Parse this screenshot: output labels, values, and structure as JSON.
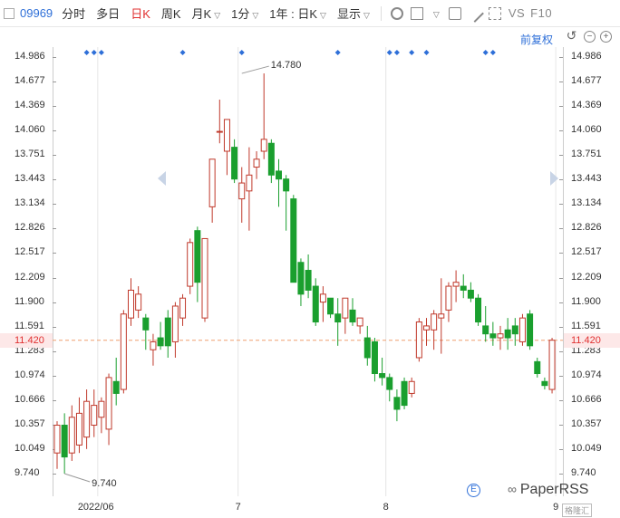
{
  "toolbar": {
    "code": "09969",
    "items": [
      {
        "label": "分时",
        "active": false,
        "caret": false
      },
      {
        "label": "多日",
        "active": false,
        "caret": false
      },
      {
        "label": "日K",
        "active": true,
        "caret": false
      },
      {
        "label": "周K",
        "active": false,
        "caret": false
      },
      {
        "label": "月K",
        "active": false,
        "caret": true
      },
      {
        "label": "1分",
        "active": false,
        "caret": true
      },
      {
        "label": "1年 : 日K",
        "active": false,
        "caret": true
      },
      {
        "label": "显示",
        "active": false,
        "caret": true
      }
    ],
    "right_text_1": "VS",
    "right_text_2": "F10",
    "icons": [
      "gear-icon",
      "checkbox-icon",
      "camera-icon",
      "pen-icon",
      "expand-icon"
    ]
  },
  "adjust_label": "前复权",
  "colors": {
    "up": "#c0392b",
    "down": "#1a9f2e",
    "axis_text": "#333333",
    "current": "#e03030",
    "marker": "#2e6fd8"
  },
  "watermark": {
    "e_icon": "E",
    "text": "PaperRSS",
    "sub": "格隆汇"
  },
  "chart_data": {
    "type": "candlestick",
    "y_ticks": [
      "14.986",
      "14.677",
      "14.369",
      "14.060",
      "13.751",
      "13.443",
      "13.134",
      "12.826",
      "12.517",
      "12.209",
      "11.900",
      "11.591",
      "11.283",
      "10.974",
      "10.666",
      "10.357",
      "10.049",
      "9.740"
    ],
    "ylim": [
      9.74,
      14.986
    ],
    "x_labels": [
      {
        "label": "2022/06",
        "index": 5.5
      },
      {
        "label": "7",
        "index": 24.5
      },
      {
        "label": "8",
        "index": 44.5
      },
      {
        "label": "9",
        "index": 67.5
      }
    ],
    "current_price": "11.420",
    "current_value": 11.42,
    "high_annotation": {
      "label": "14.780",
      "index": 25,
      "value": 14.78
    },
    "low_annotation": {
      "label": "9.740",
      "index": 1,
      "value": 9.74
    },
    "top_markers": [
      4,
      5,
      6,
      17,
      25,
      38,
      45,
      46,
      48,
      50,
      58,
      59
    ],
    "candles": [
      {
        "o": 10.0,
        "h": 10.4,
        "l": 9.8,
        "c": 10.35
      },
      {
        "o": 10.35,
        "h": 10.5,
        "l": 9.74,
        "c": 9.95
      },
      {
        "o": 10.0,
        "h": 10.6,
        "l": 9.9,
        "c": 10.45
      },
      {
        "o": 10.1,
        "h": 10.7,
        "l": 10.0,
        "c": 10.5
      },
      {
        "o": 10.2,
        "h": 10.8,
        "l": 10.05,
        "c": 10.65
      },
      {
        "o": 10.35,
        "h": 10.8,
        "l": 10.2,
        "c": 10.6
      },
      {
        "o": 10.45,
        "h": 10.7,
        "l": 10.25,
        "c": 10.65
      },
      {
        "o": 10.3,
        "h": 11.0,
        "l": 10.1,
        "c": 10.95
      },
      {
        "o": 10.9,
        "h": 11.2,
        "l": 10.6,
        "c": 10.75
      },
      {
        "o": 10.8,
        "h": 11.8,
        "l": 10.75,
        "c": 11.75
      },
      {
        "o": 11.7,
        "h": 12.2,
        "l": 11.6,
        "c": 12.05
      },
      {
        "o": 11.8,
        "h": 12.1,
        "l": 11.7,
        "c": 12.0
      },
      {
        "o": 11.7,
        "h": 11.75,
        "l": 11.3,
        "c": 11.55
      },
      {
        "o": 11.3,
        "h": 11.5,
        "l": 11.1,
        "c": 11.4
      },
      {
        "o": 11.45,
        "h": 11.65,
        "l": 11.3,
        "c": 11.35
      },
      {
        "o": 11.7,
        "h": 11.8,
        "l": 11.2,
        "c": 11.35
      },
      {
        "o": 11.4,
        "h": 11.9,
        "l": 11.2,
        "c": 11.85
      },
      {
        "o": 11.7,
        "h": 12.0,
        "l": 11.6,
        "c": 11.95
      },
      {
        "o": 12.1,
        "h": 12.7,
        "l": 12.0,
        "c": 12.65
      },
      {
        "o": 12.8,
        "h": 12.85,
        "l": 11.9,
        "c": 12.15
      },
      {
        "o": 11.7,
        "h": 12.7,
        "l": 11.65,
        "c": 12.7
      },
      {
        "o": 13.1,
        "h": 13.7,
        "l": 12.9,
        "c": 13.7
      },
      {
        "o": 14.05,
        "h": 14.45,
        "l": 13.9,
        "c": 14.05
      },
      {
        "o": 13.8,
        "h": 14.2,
        "l": 13.5,
        "c": 14.2
      },
      {
        "o": 13.85,
        "h": 13.95,
        "l": 13.4,
        "c": 13.45
      },
      {
        "o": 13.2,
        "h": 13.6,
        "l": 12.9,
        "c": 13.4
      },
      {
        "o": 13.3,
        "h": 13.85,
        "l": 12.8,
        "c": 13.5
      },
      {
        "o": 13.6,
        "h": 13.8,
        "l": 13.45,
        "c": 13.7
      },
      {
        "o": 13.8,
        "h": 14.78,
        "l": 13.7,
        "c": 13.95
      },
      {
        "o": 13.9,
        "h": 13.95,
        "l": 13.4,
        "c": 13.5
      },
      {
        "o": 13.55,
        "h": 13.7,
        "l": 13.1,
        "c": 13.45
      },
      {
        "o": 13.45,
        "h": 13.5,
        "l": 12.8,
        "c": 13.3
      },
      {
        "o": 13.2,
        "h": 13.25,
        "l": 12.15,
        "c": 12.15
      },
      {
        "o": 12.4,
        "h": 12.45,
        "l": 11.85,
        "c": 12.0
      },
      {
        "o": 12.3,
        "h": 12.5,
        "l": 11.95,
        "c": 12.05
      },
      {
        "o": 12.1,
        "h": 12.2,
        "l": 11.6,
        "c": 11.65
      },
      {
        "o": 11.9,
        "h": 12.1,
        "l": 11.65,
        "c": 12.0
      },
      {
        "o": 11.95,
        "h": 11.95,
        "l": 11.7,
        "c": 11.75
      },
      {
        "o": 11.75,
        "h": 11.95,
        "l": 11.35,
        "c": 11.65
      },
      {
        "o": 11.7,
        "h": 11.9,
        "l": 11.5,
        "c": 11.95
      },
      {
        "o": 11.8,
        "h": 11.95,
        "l": 11.6,
        "c": 11.65
      },
      {
        "o": 11.6,
        "h": 11.7,
        "l": 11.5,
        "c": 11.7
      },
      {
        "o": 11.45,
        "h": 11.6,
        "l": 11.1,
        "c": 11.2
      },
      {
        "o": 11.4,
        "h": 11.45,
        "l": 10.9,
        "c": 11.0
      },
      {
        "o": 11.0,
        "h": 11.2,
        "l": 10.85,
        "c": 10.95
      },
      {
        "o": 10.95,
        "h": 11.0,
        "l": 10.65,
        "c": 10.8
      },
      {
        "o": 10.7,
        "h": 10.8,
        "l": 10.4,
        "c": 10.55
      },
      {
        "o": 10.9,
        "h": 10.95,
        "l": 10.55,
        "c": 10.6
      },
      {
        "o": 10.75,
        "h": 10.95,
        "l": 10.7,
        "c": 10.9
      },
      {
        "o": 11.2,
        "h": 11.7,
        "l": 11.15,
        "c": 11.65
      },
      {
        "o": 11.55,
        "h": 11.7,
        "l": 11.35,
        "c": 11.6
      },
      {
        "o": 11.55,
        "h": 11.8,
        "l": 11.3,
        "c": 11.75
      },
      {
        "o": 11.7,
        "h": 12.2,
        "l": 11.25,
        "c": 11.75
      },
      {
        "o": 11.8,
        "h": 12.15,
        "l": 11.65,
        "c": 12.1
      },
      {
        "o": 12.1,
        "h": 12.3,
        "l": 11.9,
        "c": 12.15
      },
      {
        "o": 12.1,
        "h": 12.25,
        "l": 11.95,
        "c": 12.05
      },
      {
        "o": 12.05,
        "h": 12.15,
        "l": 11.9,
        "c": 11.95
      },
      {
        "o": 11.95,
        "h": 12.0,
        "l": 11.6,
        "c": 11.65
      },
      {
        "o": 11.6,
        "h": 11.85,
        "l": 11.4,
        "c": 11.5
      },
      {
        "o": 11.5,
        "h": 11.65,
        "l": 11.35,
        "c": 11.45
      },
      {
        "o": 11.45,
        "h": 11.6,
        "l": 11.3,
        "c": 11.5
      },
      {
        "o": 11.55,
        "h": 11.7,
        "l": 11.3,
        "c": 11.45
      },
      {
        "o": 11.6,
        "h": 11.7,
        "l": 11.35,
        "c": 11.5
      },
      {
        "o": 11.4,
        "h": 11.75,
        "l": 11.35,
        "c": 11.7
      },
      {
        "o": 11.75,
        "h": 11.8,
        "l": 11.3,
        "c": 11.35
      },
      {
        "o": 11.15,
        "h": 11.2,
        "l": 10.95,
        "c": 11.0
      },
      {
        "o": 10.9,
        "h": 10.95,
        "l": 10.8,
        "c": 10.85
      },
      {
        "o": 10.8,
        "h": 11.45,
        "l": 10.75,
        "c": 11.42
      }
    ]
  }
}
